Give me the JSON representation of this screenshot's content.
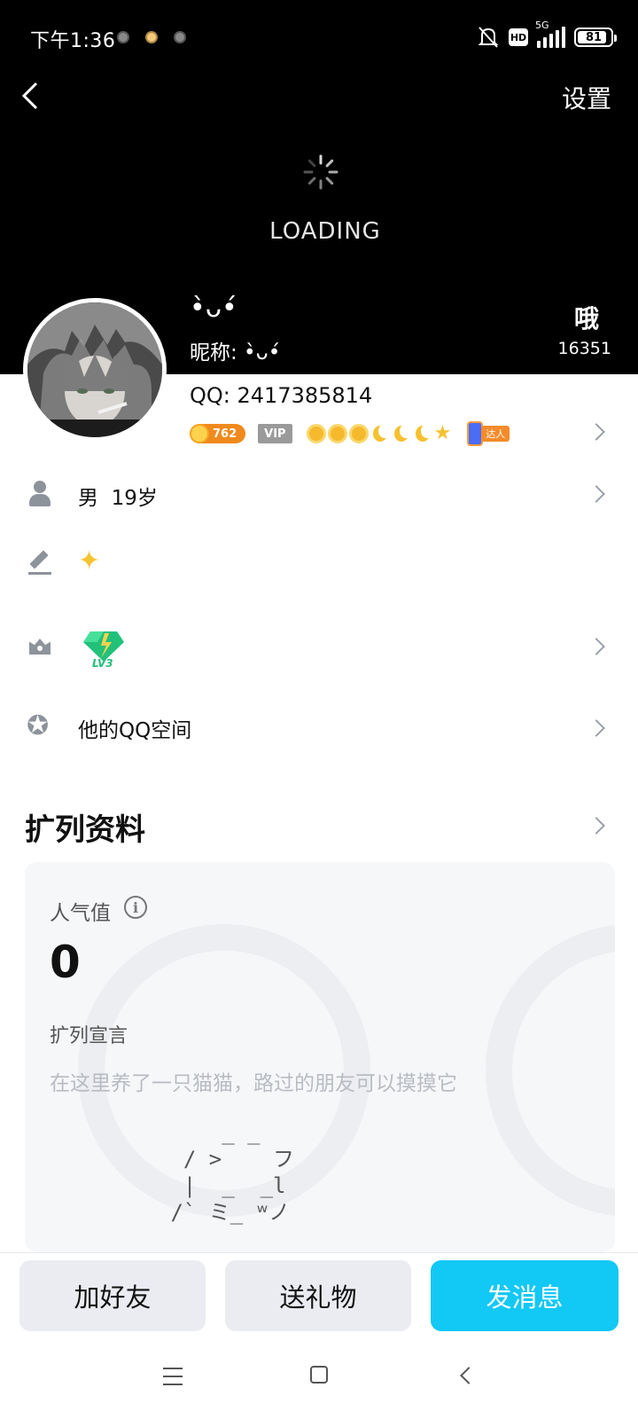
{
  "status_bar": {
    "time": "下午1:36",
    "network": "5G",
    "hd": "HD",
    "battery": "81"
  },
  "header": {
    "settings_label": "设置",
    "loading_text": "LOADING",
    "nickname_display": "•̀ᴗ•́",
    "nickname_prefix": "昵称:",
    "nickname_value": " •̀ᴗ•́",
    "likes_label": "哦",
    "likes_count": "16351"
  },
  "profile": {
    "qq_label": "QQ:",
    "qq_number": "2417385814",
    "coin_value": "762",
    "vip_label": "VIP",
    "talent_label": "达人"
  },
  "rows": {
    "gender": "男",
    "age": "19岁",
    "qzone": "他的QQ空间"
  },
  "extended": {
    "title": "扩列资料",
    "popularity_label": "人气值",
    "popularity_value": "0",
    "declaration_label": "扩列宣言",
    "declaration_text": "在这里养了一只猫猫，路过的朋友可以摸摸它",
    "cat_art": "     _ _\n  / >    フ\n  |  _  _l\n /` ミ_ ʷノ"
  },
  "actions": {
    "add_friend": "加好友",
    "send_gift": "送礼物",
    "send_message": "发消息"
  },
  "colors": {
    "accent": "#12c8f5",
    "header_bg": "#000000"
  }
}
